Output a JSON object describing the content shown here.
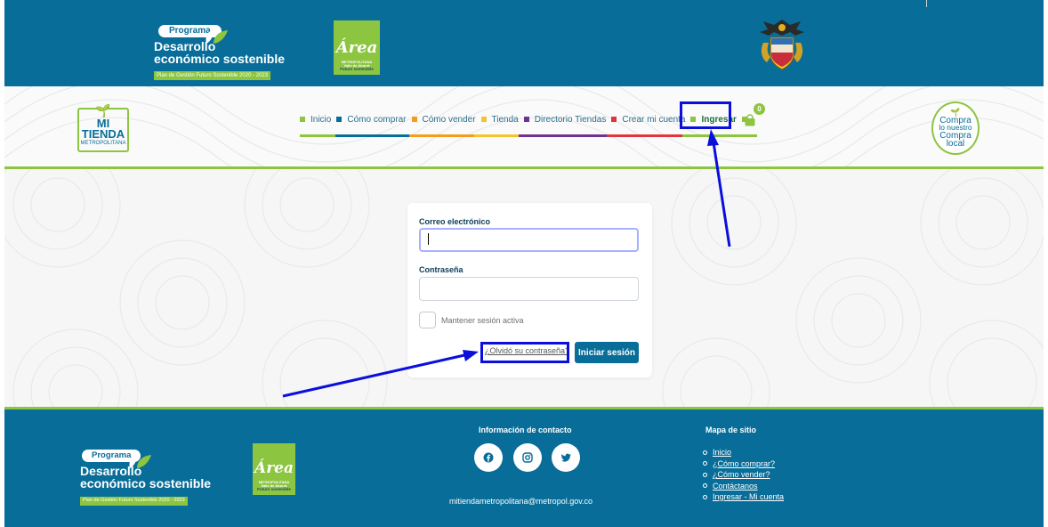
{
  "header": {
    "program_logo": {
      "pill": "Programa",
      "line1": "Desarrollo",
      "line2": "económico sostenible",
      "plan": "Plan de Gestión Futuro Sostenible 2020 - 2023"
    },
    "area_logo": {
      "script": "Área",
      "line1": "METROPOLITANA",
      "line2": "Valle de Aburrá",
      "line3": "Futuro sostenible"
    }
  },
  "brand": {
    "tienda_logo": {
      "line1": "MI",
      "line2": "TIENDA",
      "line3": "METROPOLITANA"
    },
    "compra_logo": {
      "line1": "Compra",
      "line2": "lo nuestro",
      "line3": "Compra",
      "line4": "local"
    }
  },
  "nav": {
    "items": [
      {
        "label": "Inicio",
        "color": "#8cc540"
      },
      {
        "label": "Cómo comprar",
        "color": "#086e99"
      },
      {
        "label": "Cómo vender",
        "color": "#f39c1f"
      },
      {
        "label": "Tienda",
        "color": "#f5c42c"
      },
      {
        "label": "Directorio Tiendas",
        "color": "#6b3494"
      },
      {
        "label": "Crear mi cuenta",
        "color": "#e2343f"
      },
      {
        "label": "Ingresar",
        "color": "#8cc540"
      }
    ],
    "active": "Ingresar",
    "cart_count": "0"
  },
  "login": {
    "email_label": "Correo electrónico",
    "email_value": "",
    "password_label": "Contraseña",
    "password_value": "",
    "remember_label": "Mantener sesión activa",
    "forgot_label": "¿Olvidó su contraseña?",
    "submit_label": "Iniciar sesión"
  },
  "footer": {
    "contact_heading": "Información de contacto",
    "social": [
      "facebook-icon",
      "instagram-icon",
      "twitter-icon"
    ],
    "email": "mitiendametropolitana@metropol.gov.co",
    "sitemap_heading": "Mapa de sitio",
    "sitemap_links": [
      "Inicio",
      "¿Cómo comprar?",
      "¿Cómo vender?",
      "Contáctanos",
      "Ingresar - Mi cuenta"
    ]
  },
  "colors": {
    "primary": "#086e99",
    "accent_green": "#8cc540",
    "highlight": "#0a0fdc"
  }
}
